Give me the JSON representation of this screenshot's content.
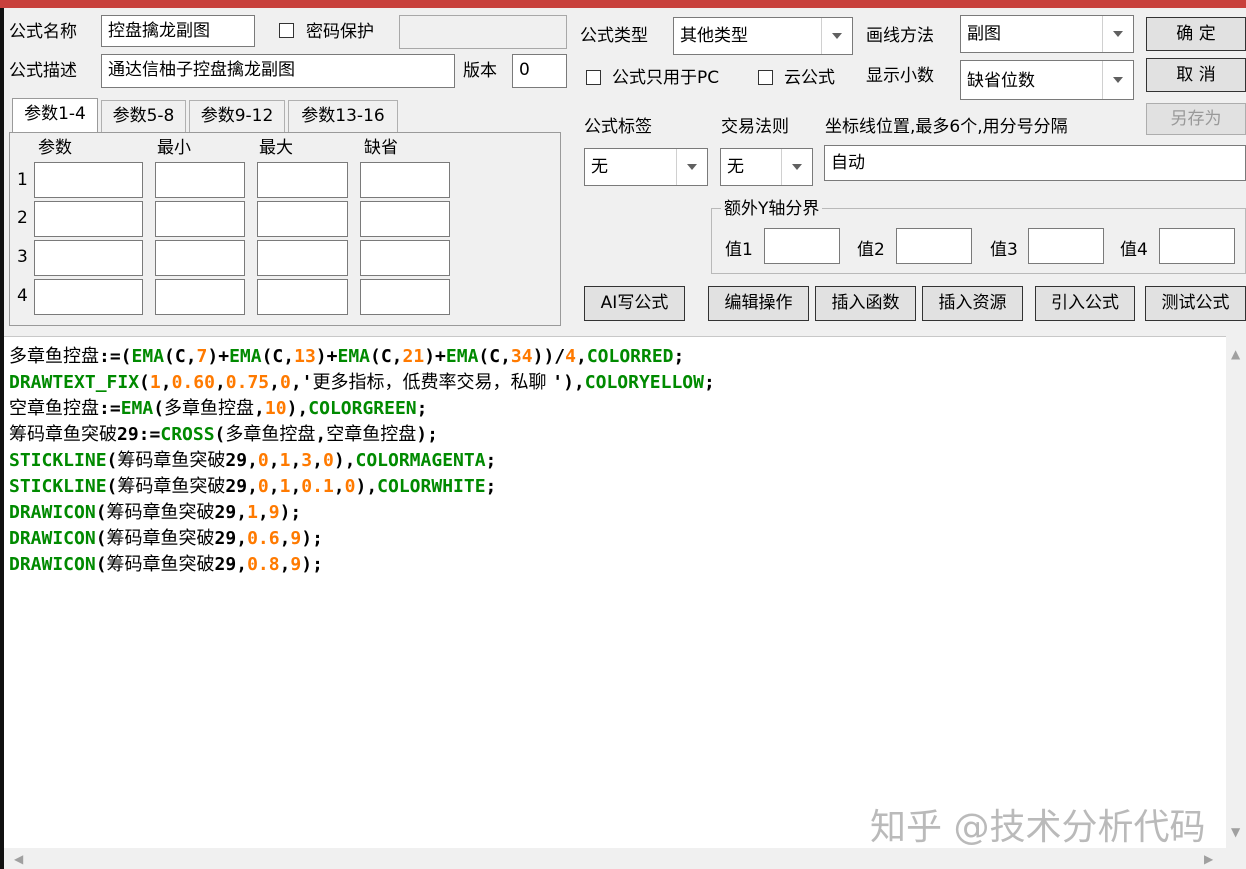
{
  "header": {
    "name_label": "公式名称",
    "name_value": "控盘擒龙副图",
    "password_label": "密码保护",
    "desc_label": "公式描述",
    "desc_value": "通达信柚子控盘擒龙副图",
    "version_label": "版本",
    "version_value": "0",
    "type_label": "公式类型",
    "type_value": "其他类型",
    "draw_label": "画线方法",
    "draw_value": "副图",
    "pc_only_label": "公式只用于PC",
    "cloud_label": "云公式",
    "decimals_label": "显示小数",
    "decimals_value": "缺省位数"
  },
  "buttons": {
    "ok": "确  定",
    "cancel": "取  消",
    "save_as": "另存为"
  },
  "params": {
    "tabs": [
      "参数1-4",
      "参数5-8",
      "参数9-12",
      "参数13-16"
    ],
    "columns": [
      "参数",
      "最小",
      "最大",
      "缺省"
    ],
    "rows": [
      "1",
      "2",
      "3",
      "4"
    ]
  },
  "right": {
    "tag_label": "公式标签",
    "tag_value": "无",
    "rule_label": "交易法则",
    "rule_value": "无",
    "axis_label": "坐标线位置,最多6个,用分号分隔",
    "axis_value": "自动",
    "yaxis_group": "额外Y轴分界",
    "val1": "值1",
    "val2": "值2",
    "val3": "值3",
    "val4": "值4"
  },
  "actions": [
    "AI写公式",
    "编辑操作",
    "插入函数",
    "插入资源",
    "引入公式",
    "测试公式"
  ],
  "colors": {
    "keyword": "#008a00",
    "number": "#ff7a00",
    "text": "#000000",
    "titlebar": "#c8403c"
  },
  "code_lines": [
    [
      [
        "多章鱼控盘",
        "t"
      ],
      [
        ":=(",
        "t"
      ],
      [
        "EMA",
        "k"
      ],
      [
        "(C,",
        "t"
      ],
      [
        "7",
        "n"
      ],
      [
        ")+",
        "t"
      ],
      [
        "EMA",
        "k"
      ],
      [
        "(C,",
        "t"
      ],
      [
        "13",
        "n"
      ],
      [
        ")+",
        "t"
      ],
      [
        "EMA",
        "k"
      ],
      [
        "(C,",
        "t"
      ],
      [
        "21",
        "n"
      ],
      [
        ")+",
        "t"
      ],
      [
        "EMA",
        "k"
      ],
      [
        "(C,",
        "t"
      ],
      [
        "34",
        "n"
      ],
      [
        "))/",
        "t"
      ],
      [
        "4",
        "n"
      ],
      [
        ",",
        "t"
      ],
      [
        "COLORRED",
        "k"
      ],
      [
        ";",
        "t"
      ]
    ],
    [
      [
        "DRAWTEXT_FIX",
        "k"
      ],
      [
        "(",
        "t"
      ],
      [
        "1",
        "n"
      ],
      [
        ",",
        "t"
      ],
      [
        "0.60",
        "n"
      ],
      [
        ",",
        "t"
      ],
      [
        "0.75",
        "n"
      ],
      [
        ",",
        "t"
      ],
      [
        "0",
        "n"
      ],
      [
        ",'",
        "t"
      ],
      [
        "更多指标，低费率交易，私聊 ",
        "t"
      ],
      [
        "'),",
        "t"
      ],
      [
        "COLORYELLOW",
        "k"
      ],
      [
        ";",
        "t"
      ]
    ],
    [
      [
        "空章鱼控盘",
        "t"
      ],
      [
        ":=",
        "t"
      ],
      [
        "EMA",
        "k"
      ],
      [
        "(",
        "t"
      ],
      [
        "多章鱼控盘",
        "t"
      ],
      [
        ",",
        "t"
      ],
      [
        "10",
        "n"
      ],
      [
        "),",
        "t"
      ],
      [
        "COLORGREEN",
        "k"
      ],
      [
        ";",
        "t"
      ]
    ],
    [
      [
        "筹码章鱼突破",
        "t"
      ],
      [
        "29:=",
        "t"
      ],
      [
        "CROSS",
        "k"
      ],
      [
        "(",
        "t"
      ],
      [
        "多章鱼控盘",
        "t"
      ],
      [
        ",",
        "t"
      ],
      [
        "空章鱼控盘",
        "t"
      ],
      [
        ");",
        "t"
      ]
    ],
    [
      [
        "STICKLINE",
        "k"
      ],
      [
        "(",
        "t"
      ],
      [
        "筹码章鱼突破",
        "t"
      ],
      [
        "29,",
        "t"
      ],
      [
        "0",
        "n"
      ],
      [
        ",",
        "t"
      ],
      [
        "1",
        "n"
      ],
      [
        ",",
        "t"
      ],
      [
        "3",
        "n"
      ],
      [
        ",",
        "t"
      ],
      [
        "0",
        "n"
      ],
      [
        "),",
        "t"
      ],
      [
        "COLORMAGENTA",
        "k"
      ],
      [
        ";",
        "t"
      ]
    ],
    [
      [
        "STICKLINE",
        "k"
      ],
      [
        "(",
        "t"
      ],
      [
        "筹码章鱼突破",
        "t"
      ],
      [
        "29,",
        "t"
      ],
      [
        "0",
        "n"
      ],
      [
        ",",
        "t"
      ],
      [
        "1",
        "n"
      ],
      [
        ",",
        "t"
      ],
      [
        "0.1",
        "n"
      ],
      [
        ",",
        "t"
      ],
      [
        "0",
        "n"
      ],
      [
        "),",
        "t"
      ],
      [
        "COLORWHITE",
        "k"
      ],
      [
        ";",
        "t"
      ]
    ],
    [
      [
        "DRAWICON",
        "k"
      ],
      [
        "(",
        "t"
      ],
      [
        "筹码章鱼突破",
        "t"
      ],
      [
        "29,",
        "t"
      ],
      [
        "1",
        "n"
      ],
      [
        ",",
        "t"
      ],
      [
        "9",
        "n"
      ],
      [
        ");",
        "t"
      ]
    ],
    [
      [
        "DRAWICON",
        "k"
      ],
      [
        "(",
        "t"
      ],
      [
        "筹码章鱼突破",
        "t"
      ],
      [
        "29,",
        "t"
      ],
      [
        "0.6",
        "n"
      ],
      [
        ",",
        "t"
      ],
      [
        "9",
        "n"
      ],
      [
        ");",
        "t"
      ]
    ],
    [
      [
        "DRAWICON",
        "k"
      ],
      [
        "(",
        "t"
      ],
      [
        "筹码章鱼突破",
        "t"
      ],
      [
        "29,",
        "t"
      ],
      [
        "0.8",
        "n"
      ],
      [
        ",",
        "t"
      ],
      [
        "9",
        "n"
      ],
      [
        ");",
        "t"
      ]
    ]
  ],
  "watermark": "知乎 @技术分析代码"
}
